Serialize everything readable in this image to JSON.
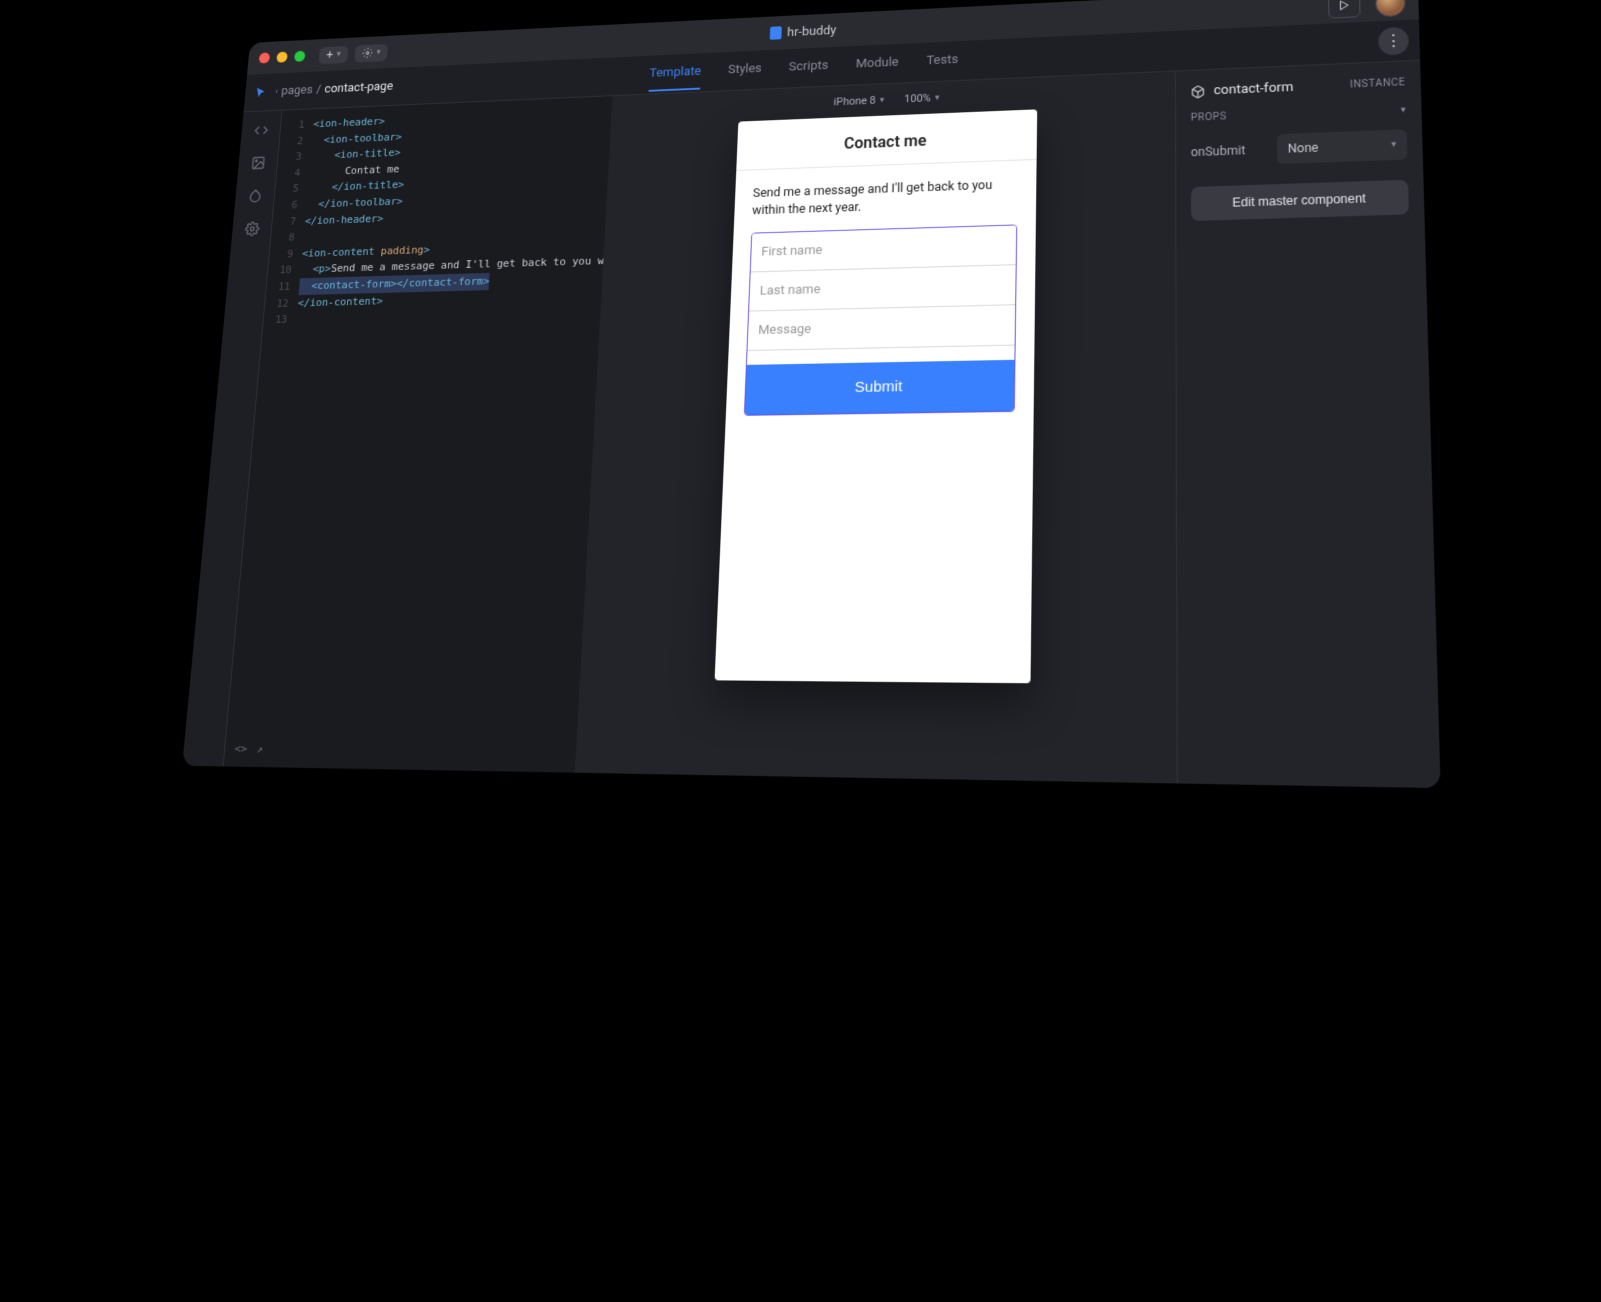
{
  "titlebar": {
    "project_name": "hr-buddy"
  },
  "breadcrumb": {
    "parent": "pages",
    "current": "contact-page"
  },
  "tabs": [
    {
      "label": "Template",
      "active": true
    },
    {
      "label": "Styles",
      "active": false
    },
    {
      "label": "Scripts",
      "active": false
    },
    {
      "label": "Module",
      "active": false
    },
    {
      "label": "Tests",
      "active": false
    }
  ],
  "code": {
    "lines": [
      {
        "n": 1,
        "html": "<span class='tag-open'>&lt;ion-header&gt;</span>"
      },
      {
        "n": 2,
        "html": "  <span class='tag-open'>&lt;ion-toolbar&gt;</span>"
      },
      {
        "n": 3,
        "html": "    <span class='tag-open'>&lt;ion-title&gt;</span>"
      },
      {
        "n": 4,
        "html": "      <span class='txt'>Contat me</span>"
      },
      {
        "n": 5,
        "html": "    <span class='tag-close'>&lt;/ion-title&gt;</span>"
      },
      {
        "n": 6,
        "html": "  <span class='tag-close'>&lt;/ion-toolbar&gt;</span>"
      },
      {
        "n": 7,
        "html": "<span class='tag-close'>&lt;/ion-header&gt;</span>"
      },
      {
        "n": 8,
        "html": ""
      },
      {
        "n": 9,
        "html": "<span class='tag-open'>&lt;ion-content <span class='tag-attr'>padding</span>&gt;</span>"
      },
      {
        "n": 10,
        "html": "  <span class='tag-open'>&lt;p&gt;</span><span class='txt'>Send me a message and I'll get back to you within the next year.</span><span class='tag-close'>&lt;</span>"
      },
      {
        "n": 11,
        "html": "  <span class='tag-open'>&lt;contact-form&gt;</span><span class='tag-close'>&lt;/contact-form&gt;</span>",
        "hl": true
      },
      {
        "n": 12,
        "html": "<span class='tag-close'>&lt;/ion-content&gt;</span>"
      },
      {
        "n": 13,
        "html": ""
      }
    ],
    "footer_left": "<>",
    "footer_right": "↗"
  },
  "preview": {
    "device_label": "iPhone 8",
    "zoom_label": "100%",
    "page_title": "Contact me",
    "intro_text": "Send me a message and I'll get back to you within the next year.",
    "first_name_placeholder": "First name",
    "last_name_placeholder": "Last name",
    "message_placeholder": "Message",
    "submit_label": "Submit"
  },
  "inspector": {
    "component_name": "contact-form",
    "badge": "INSTANCE",
    "props_label": "PROPS",
    "prop_name": "onSubmit",
    "prop_value": "None",
    "edit_master_label": "Edit master component"
  }
}
